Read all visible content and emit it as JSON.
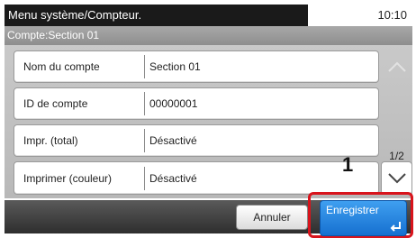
{
  "header": {
    "title": "Menu système/Compteur.",
    "time": "10:10",
    "subtitle": "Compte:Section 01"
  },
  "rows": [
    {
      "label": "Nom du compte",
      "value": "Section 01"
    },
    {
      "label": "ID de compte",
      "value": "00000001"
    },
    {
      "label": "Impr. (total)",
      "value": "Désactivé"
    },
    {
      "label": "Imprimer (couleur)",
      "value": "Désactivé"
    }
  ],
  "pager": {
    "page": "1/2"
  },
  "footer": {
    "cancel_label": "Annuler",
    "save_label": "Enregistrer"
  },
  "annotation": {
    "step": "1",
    "highlight_color": "#d8141c"
  },
  "icons": {
    "up": "chevron-up-icon",
    "down": "chevron-down-icon",
    "enter": "enter-icon"
  }
}
